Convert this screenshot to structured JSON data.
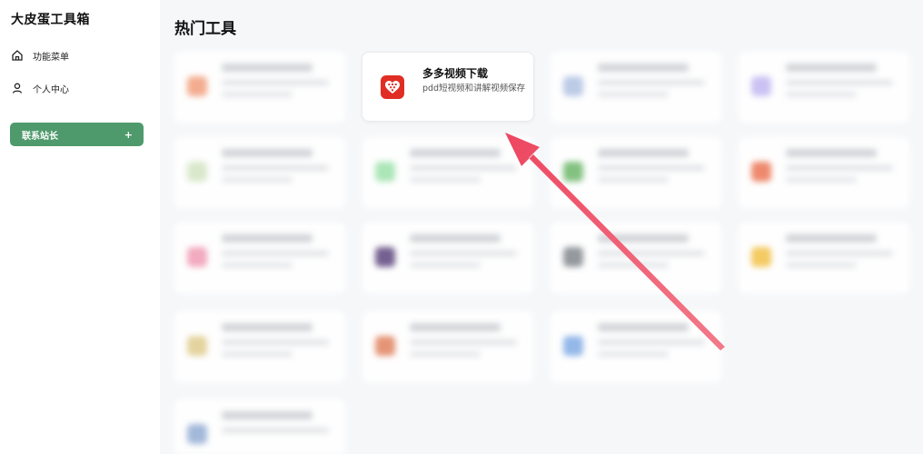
{
  "sidebar": {
    "brand": "大皮蛋工具箱",
    "items": [
      {
        "label": "功能菜单",
        "icon": "home-icon"
      },
      {
        "label": "个人中心",
        "icon": "user-icon"
      }
    ],
    "contact_button": {
      "label": "联系站长",
      "icon": "plus-icon"
    }
  },
  "main": {
    "title": "热门工具",
    "featured_card": {
      "title": "多多视频下载",
      "description": "pdd短视频和讲解视频保存",
      "icon": "pinduoduo-icon"
    }
  },
  "colors": {
    "accent_green": "#4f9a6c",
    "pdd_red": "#e02e24",
    "arrow_red": "#f2546a"
  }
}
